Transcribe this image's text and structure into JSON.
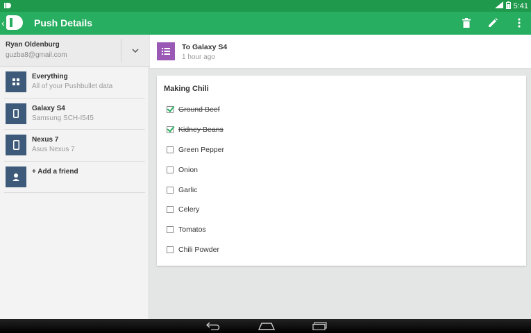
{
  "status_bar": {
    "time": "5:41",
    "icons": [
      "notification-icon",
      "wifi-icon",
      "battery-icon"
    ]
  },
  "app_bar": {
    "title": "Push Details",
    "actions": [
      "delete-icon",
      "edit-icon",
      "overflow-menu-icon"
    ],
    "colors": {
      "primary": "#27ae60",
      "status": "#1f9a4c"
    }
  },
  "account": {
    "name": "Ryan Oldenburg",
    "email": "guzba8@gmail.com"
  },
  "devices": [
    {
      "name": "Everything",
      "subtitle": "All of your Pushbullet data",
      "icon": "grid-icon"
    },
    {
      "name": "Galaxy S4",
      "subtitle": "Samsung SCH-I545",
      "icon": "phone-icon"
    },
    {
      "name": "Nexus 7",
      "subtitle": "Asus Nexus 7",
      "icon": "tablet-icon"
    },
    {
      "name": "+ Add a friend",
      "subtitle": "",
      "icon": "person-icon"
    }
  ],
  "push": {
    "target": "To Galaxy S4",
    "time": "1 hour ago",
    "type_icon": "list-icon",
    "type_color": "#9b59b6"
  },
  "list": {
    "title": "Making Chili",
    "items": [
      {
        "label": "Ground Beef",
        "checked": true
      },
      {
        "label": "Kidney Beans",
        "checked": true
      },
      {
        "label": "Green Pepper",
        "checked": false
      },
      {
        "label": "Onion",
        "checked": false
      },
      {
        "label": "Garlic",
        "checked": false
      },
      {
        "label": "Celery",
        "checked": false
      },
      {
        "label": "Tomatos",
        "checked": false
      },
      {
        "label": "Chili Powder",
        "checked": false
      }
    ]
  },
  "nav_bar": {
    "buttons": [
      "back-icon",
      "home-icon",
      "recents-icon"
    ]
  }
}
